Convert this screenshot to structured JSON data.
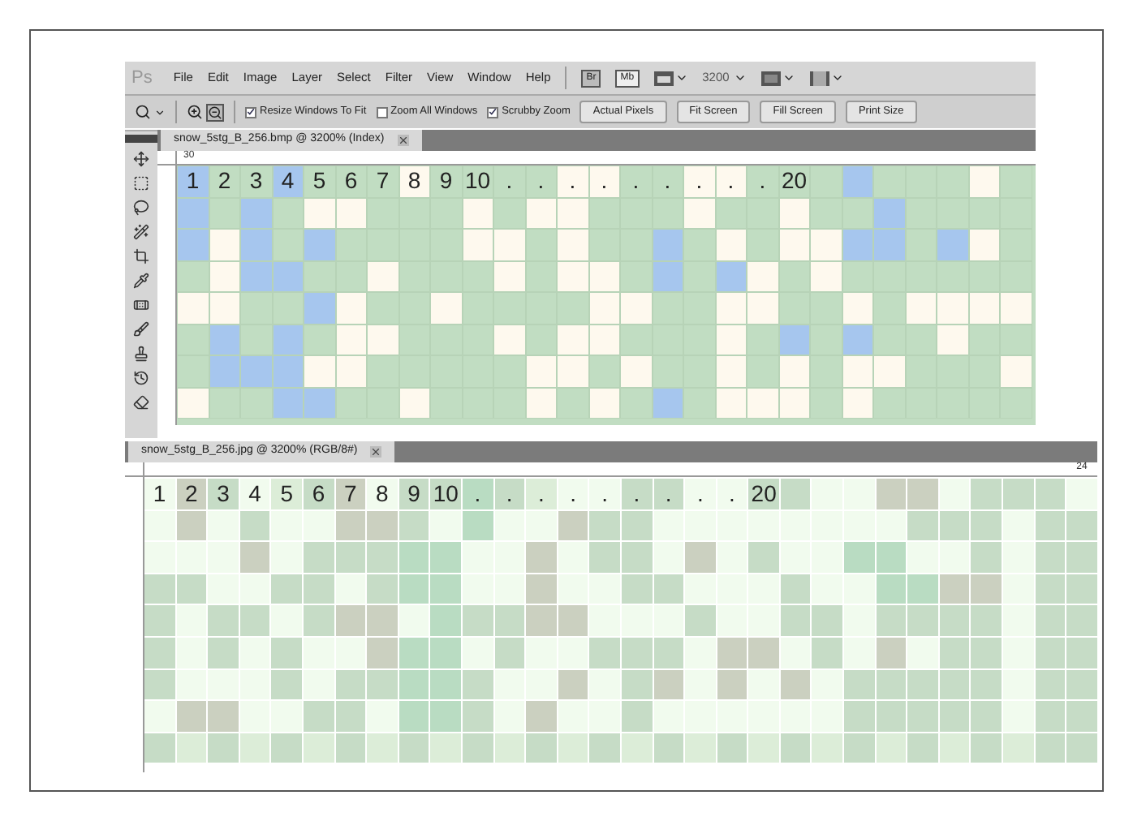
{
  "app": {
    "logo": "Ps"
  },
  "menu": [
    "File",
    "Edit",
    "Image",
    "Layer",
    "Select",
    "Filter",
    "View",
    "Window",
    "Help"
  ],
  "app_bar": {
    "bridge": "Br",
    "mini_bridge": "Mb",
    "zoom": "3200"
  },
  "options": [
    {
      "label": "Resize Windows To Fit",
      "checked": true
    },
    {
      "label": "Zoom All Windows",
      "checked": false
    },
    {
      "label": "Scrubby Zoom",
      "checked": true
    }
  ],
  "buttons": [
    "Actual Pixels",
    "Fit Screen",
    "Fill Screen",
    "Print Size"
  ],
  "documents": [
    {
      "tab": "snow_5stg_B_256.bmp @ 3200% (Index)",
      "ruler": "30",
      "labels": [
        "1",
        "2",
        "3",
        "4",
        "5",
        "6",
        "7",
        "8",
        "9",
        "10",
        ".",
        ".",
        ".",
        ".",
        ".",
        ".",
        ".",
        ".",
        ".",
        "20"
      ]
    },
    {
      "tab": "snow_5stg_B_256.jpg @ 3200% (RGB/8#)",
      "ruler": "24",
      "labels": [
        "1",
        "2",
        "3",
        "4",
        "5",
        "6",
        "7",
        "8",
        "9",
        "10",
        ".",
        ".",
        ".",
        ".",
        ".",
        ".",
        ".",
        ".",
        ".",
        "20"
      ]
    }
  ]
}
